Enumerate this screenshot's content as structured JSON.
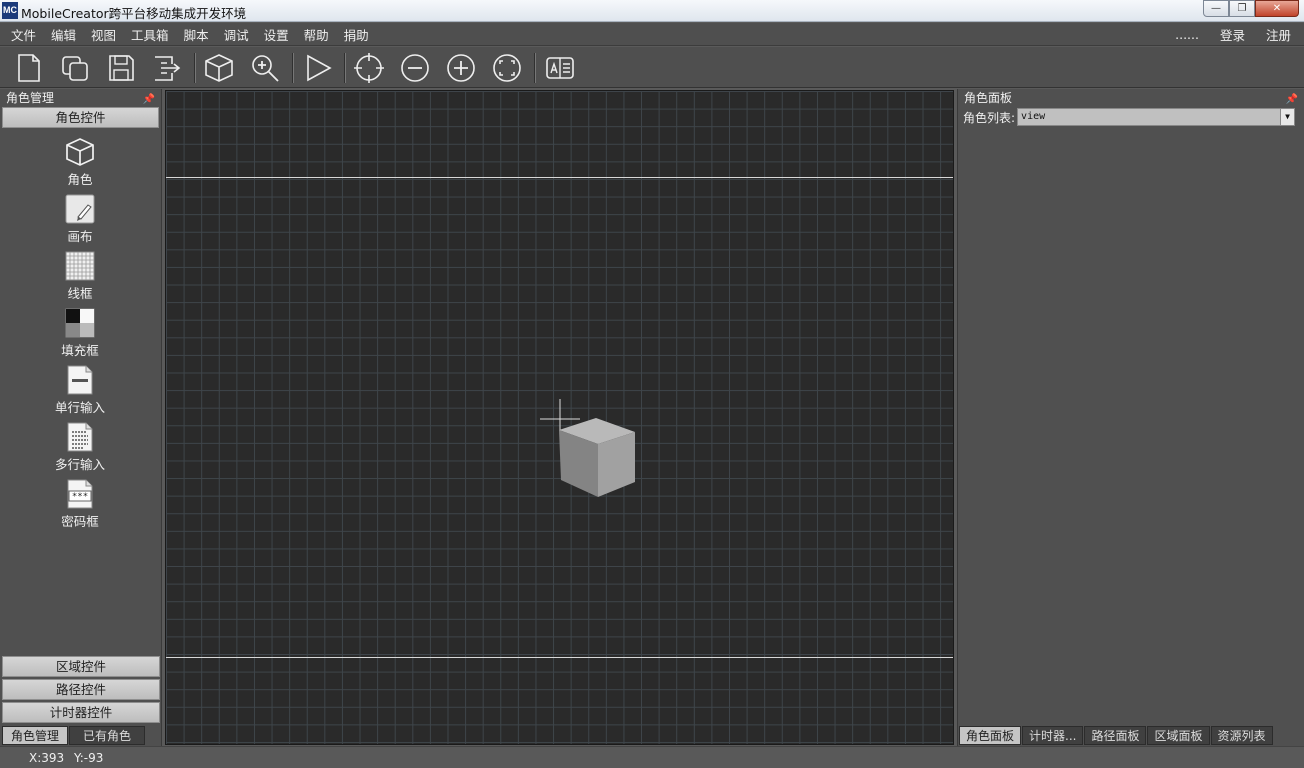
{
  "window": {
    "title": "MobileCreator跨平台移动集成开发环境",
    "app_icon": "MC"
  },
  "menu": {
    "left": [
      "文件",
      "编辑",
      "视图",
      "工具箱",
      "脚本",
      "调试",
      "设置",
      "帮助",
      "捐助"
    ],
    "right": [
      "......",
      "登录",
      "注册"
    ]
  },
  "toolbar": {
    "icons": [
      "new-file-icon",
      "open-icon",
      "save-icon",
      "export-icon",
      "cube-icon",
      "zoom-search-icon",
      "play-icon",
      "crosshair-icon",
      "zoom-out-icon",
      "zoom-in-icon",
      "fit-screen-icon",
      "resource-icon"
    ]
  },
  "left_panel": {
    "title": "角色管理",
    "active_section": "角色控件",
    "tools": [
      {
        "label": "角色",
        "icon": "cube-icon"
      },
      {
        "label": "画布",
        "icon": "canvas-icon"
      },
      {
        "label": "线框",
        "icon": "wireframe-icon"
      },
      {
        "label": "填充框",
        "icon": "fill-frame-icon"
      },
      {
        "label": "单行输入",
        "icon": "single-line-input-icon"
      },
      {
        "label": "多行输入",
        "icon": "multi-line-input-icon"
      },
      {
        "label": "密码框",
        "icon": "password-box-icon"
      }
    ],
    "password_glyph": "***",
    "sections": [
      "区域控件",
      "路径控件",
      "计时器控件"
    ],
    "tabs": [
      "角色管理",
      "已有角色"
    ]
  },
  "right_panel": {
    "title": "角色面板",
    "role_list_label": "角色列表:",
    "role_list_value": "view",
    "tabs": [
      "角色面板",
      "计时器...",
      "路径面板",
      "区域面板",
      "资源列表"
    ]
  },
  "status": {
    "x_text": "X:393",
    "y_text": "Y:-93"
  },
  "colors": {
    "canvas_bg": "#2a2a2a",
    "grid": "#3e454a",
    "panel_bg": "#505050",
    "menu_bg": "#4f4f4f"
  }
}
